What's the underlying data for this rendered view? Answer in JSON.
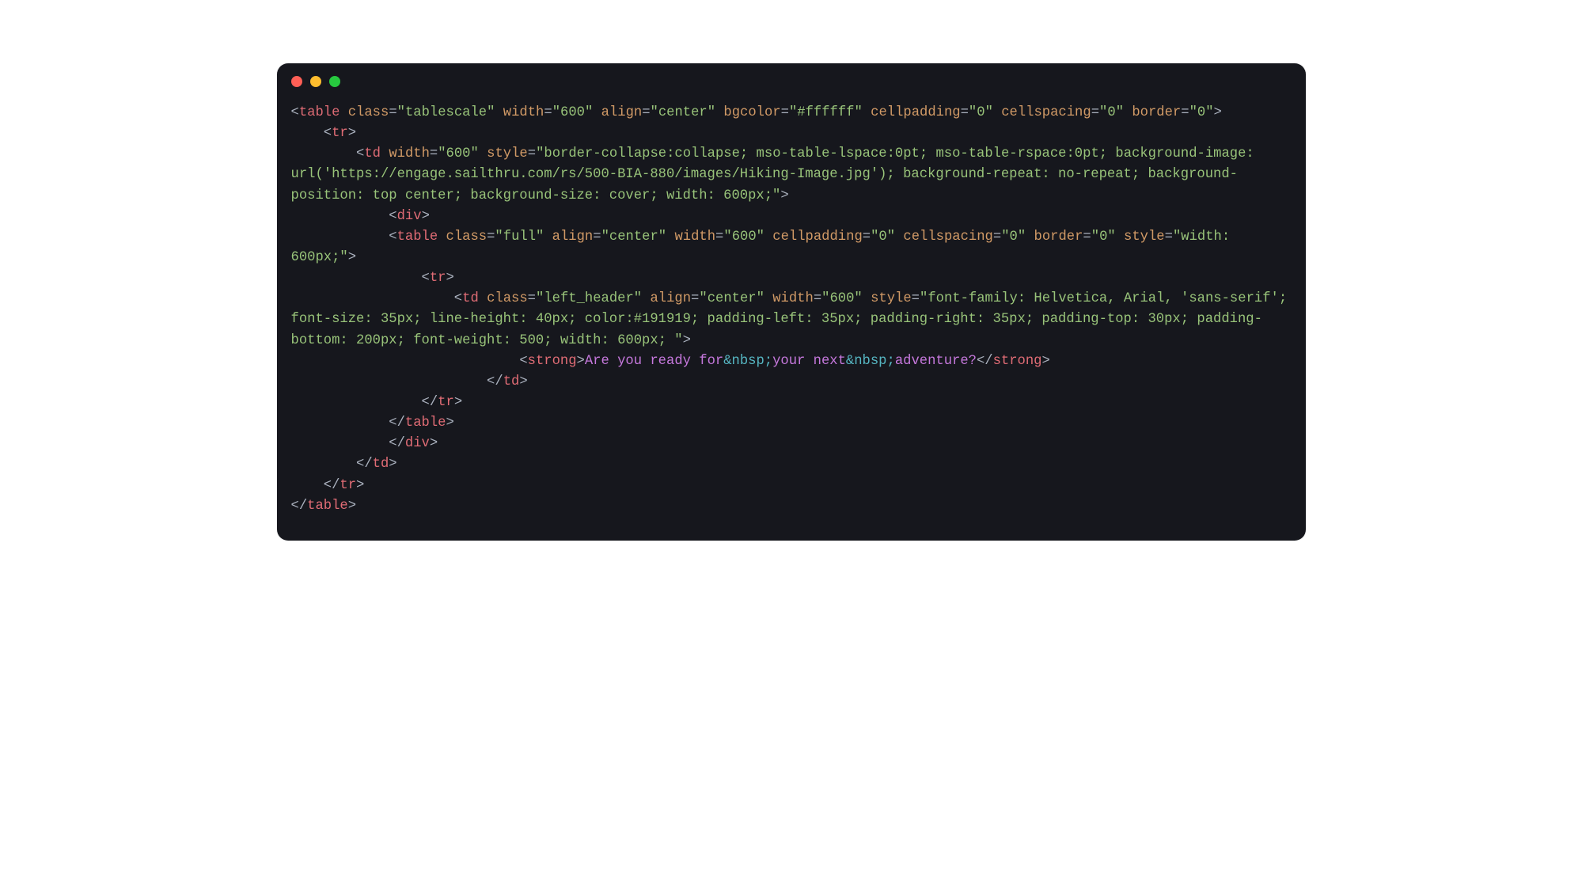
{
  "code": {
    "outer_table": {
      "class": "tablescale",
      "width": "600",
      "align": "center",
      "bgcolor": "#ffffff",
      "cellpadding": "0",
      "cellspacing": "0",
      "border": "0"
    },
    "outer_td": {
      "width": "600",
      "style": "border-collapse:collapse; mso-table-lspace:0pt; mso-table-rspace:0pt; background-image: url('https://engage.sailthru.com/rs/500-BIA-880/images/Hiking-Image.jpg'); background-repeat: no-repeat; background-position: top center; background-size: cover; width: 600px;"
    },
    "inner_table": {
      "class": "full",
      "align": "center",
      "width": "600",
      "cellpadding": "0",
      "cellspacing": "0",
      "border": "0",
      "style": "width: 600px;"
    },
    "inner_td": {
      "class": "left_header",
      "align": "center",
      "width": "600",
      "style": "font-family: Helvetica, Arial, 'sans-serif'; font-size: 35px; line-height: 40px; color:#191919; padding-left: 35px; padding-right: 35px; padding-top: 30px; padding-bottom: 200px; font-weight: 500; width: 600px; "
    },
    "strong_text_parts": {
      "p1": "Are you ready for",
      "nbsp": "&nbsp;",
      "p2": "your next",
      "p3": "adventure?"
    }
  }
}
